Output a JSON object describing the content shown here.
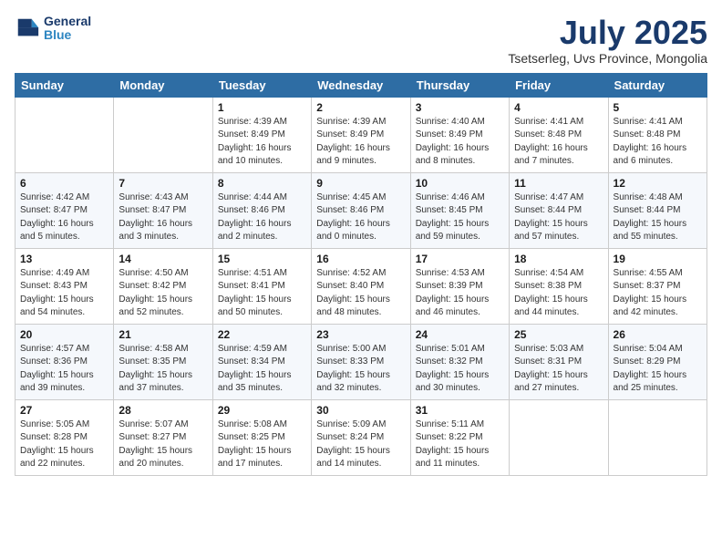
{
  "logo": {
    "line1": "General",
    "line2": "Blue"
  },
  "title": "July 2025",
  "location": "Tsetserleg, Uvs Province, Mongolia",
  "weekdays": [
    "Sunday",
    "Monday",
    "Tuesday",
    "Wednesday",
    "Thursday",
    "Friday",
    "Saturday"
  ],
  "weeks": [
    [
      {
        "day": null
      },
      {
        "day": null
      },
      {
        "day": "1",
        "sunrise": "Sunrise: 4:39 AM",
        "sunset": "Sunset: 8:49 PM",
        "daylight": "Daylight: 16 hours and 10 minutes."
      },
      {
        "day": "2",
        "sunrise": "Sunrise: 4:39 AM",
        "sunset": "Sunset: 8:49 PM",
        "daylight": "Daylight: 16 hours and 9 minutes."
      },
      {
        "day": "3",
        "sunrise": "Sunrise: 4:40 AM",
        "sunset": "Sunset: 8:49 PM",
        "daylight": "Daylight: 16 hours and 8 minutes."
      },
      {
        "day": "4",
        "sunrise": "Sunrise: 4:41 AM",
        "sunset": "Sunset: 8:48 PM",
        "daylight": "Daylight: 16 hours and 7 minutes."
      },
      {
        "day": "5",
        "sunrise": "Sunrise: 4:41 AM",
        "sunset": "Sunset: 8:48 PM",
        "daylight": "Daylight: 16 hours and 6 minutes."
      }
    ],
    [
      {
        "day": "6",
        "sunrise": "Sunrise: 4:42 AM",
        "sunset": "Sunset: 8:47 PM",
        "daylight": "Daylight: 16 hours and 5 minutes."
      },
      {
        "day": "7",
        "sunrise": "Sunrise: 4:43 AM",
        "sunset": "Sunset: 8:47 PM",
        "daylight": "Daylight: 16 hours and 3 minutes."
      },
      {
        "day": "8",
        "sunrise": "Sunrise: 4:44 AM",
        "sunset": "Sunset: 8:46 PM",
        "daylight": "Daylight: 16 hours and 2 minutes."
      },
      {
        "day": "9",
        "sunrise": "Sunrise: 4:45 AM",
        "sunset": "Sunset: 8:46 PM",
        "daylight": "Daylight: 16 hours and 0 minutes."
      },
      {
        "day": "10",
        "sunrise": "Sunrise: 4:46 AM",
        "sunset": "Sunset: 8:45 PM",
        "daylight": "Daylight: 15 hours and 59 minutes."
      },
      {
        "day": "11",
        "sunrise": "Sunrise: 4:47 AM",
        "sunset": "Sunset: 8:44 PM",
        "daylight": "Daylight: 15 hours and 57 minutes."
      },
      {
        "day": "12",
        "sunrise": "Sunrise: 4:48 AM",
        "sunset": "Sunset: 8:44 PM",
        "daylight": "Daylight: 15 hours and 55 minutes."
      }
    ],
    [
      {
        "day": "13",
        "sunrise": "Sunrise: 4:49 AM",
        "sunset": "Sunset: 8:43 PM",
        "daylight": "Daylight: 15 hours and 54 minutes."
      },
      {
        "day": "14",
        "sunrise": "Sunrise: 4:50 AM",
        "sunset": "Sunset: 8:42 PM",
        "daylight": "Daylight: 15 hours and 52 minutes."
      },
      {
        "day": "15",
        "sunrise": "Sunrise: 4:51 AM",
        "sunset": "Sunset: 8:41 PM",
        "daylight": "Daylight: 15 hours and 50 minutes."
      },
      {
        "day": "16",
        "sunrise": "Sunrise: 4:52 AM",
        "sunset": "Sunset: 8:40 PM",
        "daylight": "Daylight: 15 hours and 48 minutes."
      },
      {
        "day": "17",
        "sunrise": "Sunrise: 4:53 AM",
        "sunset": "Sunset: 8:39 PM",
        "daylight": "Daylight: 15 hours and 46 minutes."
      },
      {
        "day": "18",
        "sunrise": "Sunrise: 4:54 AM",
        "sunset": "Sunset: 8:38 PM",
        "daylight": "Daylight: 15 hours and 44 minutes."
      },
      {
        "day": "19",
        "sunrise": "Sunrise: 4:55 AM",
        "sunset": "Sunset: 8:37 PM",
        "daylight": "Daylight: 15 hours and 42 minutes."
      }
    ],
    [
      {
        "day": "20",
        "sunrise": "Sunrise: 4:57 AM",
        "sunset": "Sunset: 8:36 PM",
        "daylight": "Daylight: 15 hours and 39 minutes."
      },
      {
        "day": "21",
        "sunrise": "Sunrise: 4:58 AM",
        "sunset": "Sunset: 8:35 PM",
        "daylight": "Daylight: 15 hours and 37 minutes."
      },
      {
        "day": "22",
        "sunrise": "Sunrise: 4:59 AM",
        "sunset": "Sunset: 8:34 PM",
        "daylight": "Daylight: 15 hours and 35 minutes."
      },
      {
        "day": "23",
        "sunrise": "Sunrise: 5:00 AM",
        "sunset": "Sunset: 8:33 PM",
        "daylight": "Daylight: 15 hours and 32 minutes."
      },
      {
        "day": "24",
        "sunrise": "Sunrise: 5:01 AM",
        "sunset": "Sunset: 8:32 PM",
        "daylight": "Daylight: 15 hours and 30 minutes."
      },
      {
        "day": "25",
        "sunrise": "Sunrise: 5:03 AM",
        "sunset": "Sunset: 8:31 PM",
        "daylight": "Daylight: 15 hours and 27 minutes."
      },
      {
        "day": "26",
        "sunrise": "Sunrise: 5:04 AM",
        "sunset": "Sunset: 8:29 PM",
        "daylight": "Daylight: 15 hours and 25 minutes."
      }
    ],
    [
      {
        "day": "27",
        "sunrise": "Sunrise: 5:05 AM",
        "sunset": "Sunset: 8:28 PM",
        "daylight": "Daylight: 15 hours and 22 minutes."
      },
      {
        "day": "28",
        "sunrise": "Sunrise: 5:07 AM",
        "sunset": "Sunset: 8:27 PM",
        "daylight": "Daylight: 15 hours and 20 minutes."
      },
      {
        "day": "29",
        "sunrise": "Sunrise: 5:08 AM",
        "sunset": "Sunset: 8:25 PM",
        "daylight": "Daylight: 15 hours and 17 minutes."
      },
      {
        "day": "30",
        "sunrise": "Sunrise: 5:09 AM",
        "sunset": "Sunset: 8:24 PM",
        "daylight": "Daylight: 15 hours and 14 minutes."
      },
      {
        "day": "31",
        "sunrise": "Sunrise: 5:11 AM",
        "sunset": "Sunset: 8:22 PM",
        "daylight": "Daylight: 15 hours and 11 minutes."
      },
      {
        "day": null
      },
      {
        "day": null
      }
    ]
  ]
}
